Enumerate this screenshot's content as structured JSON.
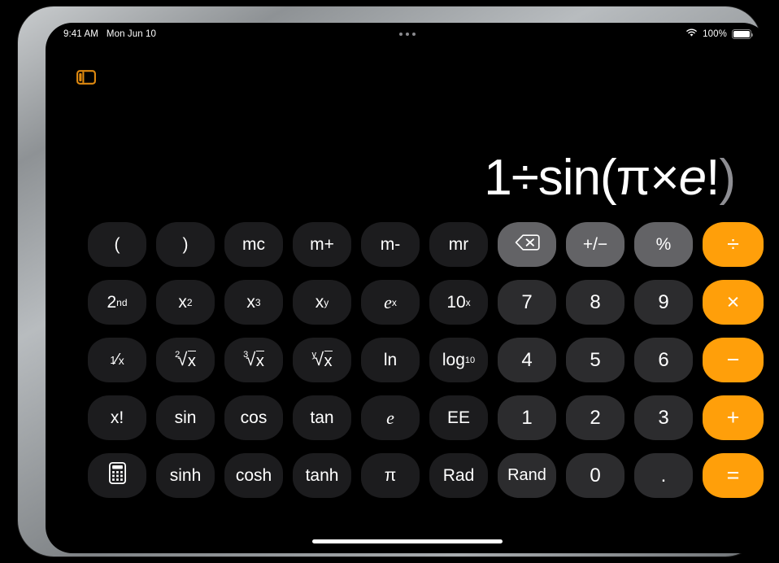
{
  "device": {
    "bezel_color": "#9a9ea1",
    "screen_bg": "#000000"
  },
  "status_bar": {
    "time": "9:41 AM",
    "date": "Mon Jun 10",
    "wifi_icon": "wifi-icon",
    "battery_percent": "100%",
    "battery_icon": "battery-icon",
    "multitask_icon": "multitask-dots-icon"
  },
  "toolbar": {
    "sidebar_toggle_icon": "sidebar-toggle-icon",
    "sidebar_toggle_color": "#e08a10"
  },
  "display": {
    "expression_parts": [
      {
        "text": "1÷sin(π×",
        "style": "normal"
      },
      {
        "text": "e",
        "style": "italic"
      },
      {
        "text": "!",
        "style": "normal"
      },
      {
        "text": ")",
        "style": "dim"
      }
    ],
    "expression_plain": "1÷sin(π×e!)",
    "text_color": "#ffffff",
    "dim_color": "#8e8e93"
  },
  "colors": {
    "function_key": "#1c1c1e",
    "number_key": "#2c2c2e",
    "utility_key": "#636366",
    "accent_key": "#ff9f0a",
    "label": "#ffffff"
  },
  "keypad": {
    "rows": [
      {
        "keys": [
          {
            "label": "(",
            "name": "key-open-paren",
            "kind": "fn"
          },
          {
            "label": ")",
            "name": "key-close-paren",
            "kind": "fn"
          },
          {
            "label": "mc",
            "name": "key-memory-clear",
            "kind": "fn"
          },
          {
            "label": "m+",
            "name": "key-memory-add",
            "kind": "fn"
          },
          {
            "label": "m-",
            "name": "key-memory-subtract",
            "kind": "fn"
          },
          {
            "label": "mr",
            "name": "key-memory-recall",
            "kind": "fn"
          },
          {
            "label": "",
            "name": "key-backspace",
            "kind": "util",
            "icon": "backspace-icon"
          },
          {
            "label": "+/−",
            "name": "key-sign-toggle",
            "kind": "util"
          },
          {
            "label": "%",
            "name": "key-percent",
            "kind": "util"
          },
          {
            "label": "÷",
            "name": "key-divide",
            "kind": "accent"
          }
        ]
      },
      {
        "keys": [
          {
            "label": "2nd",
            "name": "key-second-function",
            "kind": "fn",
            "base": "2",
            "sup": "nd"
          },
          {
            "label": "x²",
            "name": "key-x-squared",
            "kind": "fn",
            "base": "x",
            "sup": "2"
          },
          {
            "label": "x³",
            "name": "key-x-cubed",
            "kind": "fn",
            "base": "x",
            "sup": "3"
          },
          {
            "label": "xy",
            "name": "key-x-to-y",
            "kind": "fn",
            "base": "x",
            "sup": "y"
          },
          {
            "label": "ex",
            "name": "key-e-to-x",
            "kind": "fn",
            "base": "e",
            "sup": "x"
          },
          {
            "label": "10x",
            "name": "key-ten-to-x",
            "kind": "fn",
            "base": "10",
            "sup": "x"
          },
          {
            "label": "7",
            "name": "key-7",
            "kind": "num"
          },
          {
            "label": "8",
            "name": "key-8",
            "kind": "num"
          },
          {
            "label": "9",
            "name": "key-9",
            "kind": "num"
          },
          {
            "label": "×",
            "name": "key-multiply",
            "kind": "accent"
          }
        ]
      },
      {
        "keys": [
          {
            "label": "1/x",
            "name": "key-reciprocal",
            "kind": "fn"
          },
          {
            "label": "2√x",
            "name": "key-square-root",
            "kind": "fn",
            "radical_index": "2"
          },
          {
            "label": "3√x",
            "name": "key-cube-root",
            "kind": "fn",
            "radical_index": "3"
          },
          {
            "label": "y√x",
            "name": "key-nth-root",
            "kind": "fn",
            "radical_index": "y"
          },
          {
            "label": "ln",
            "name": "key-natural-log",
            "kind": "fn"
          },
          {
            "label": "log10",
            "name": "key-log-base-10",
            "kind": "fn",
            "base": "log",
            "sub": "10"
          },
          {
            "label": "4",
            "name": "key-4",
            "kind": "num"
          },
          {
            "label": "5",
            "name": "key-5",
            "kind": "num"
          },
          {
            "label": "6",
            "name": "key-6",
            "kind": "num"
          },
          {
            "label": "−",
            "name": "key-subtract",
            "kind": "accent"
          }
        ]
      },
      {
        "keys": [
          {
            "label": "x!",
            "name": "key-factorial",
            "kind": "fn"
          },
          {
            "label": "sin",
            "name": "key-sine",
            "kind": "fn"
          },
          {
            "label": "cos",
            "name": "key-cosine",
            "kind": "fn"
          },
          {
            "label": "tan",
            "name": "key-tangent",
            "kind": "fn"
          },
          {
            "label": "e",
            "name": "key-euler-number",
            "kind": "fn",
            "italic": true
          },
          {
            "label": "EE",
            "name": "key-exponent-entry",
            "kind": "fn"
          },
          {
            "label": "1",
            "name": "key-1",
            "kind": "num"
          },
          {
            "label": "2",
            "name": "key-2",
            "kind": "num"
          },
          {
            "label": "3",
            "name": "key-3",
            "kind": "num"
          },
          {
            "label": "+",
            "name": "key-add",
            "kind": "accent"
          }
        ]
      },
      {
        "keys": [
          {
            "label": "",
            "name": "key-calculator-mode",
            "kind": "fn",
            "icon": "calculator-icon"
          },
          {
            "label": "sinh",
            "name": "key-hyperbolic-sine",
            "kind": "fn"
          },
          {
            "label": "cosh",
            "name": "key-hyperbolic-cosine",
            "kind": "fn"
          },
          {
            "label": "tanh",
            "name": "key-hyperbolic-tangent",
            "kind": "fn"
          },
          {
            "label": "π",
            "name": "key-pi",
            "kind": "fn"
          },
          {
            "label": "Rad",
            "name": "key-radian-mode",
            "kind": "fn"
          },
          {
            "label": "Rand",
            "name": "key-random",
            "kind": "num"
          },
          {
            "label": "0",
            "name": "key-0",
            "kind": "num"
          },
          {
            "label": ".",
            "name": "key-decimal-point",
            "kind": "num"
          },
          {
            "label": "=",
            "name": "key-equals",
            "kind": "accent"
          }
        ]
      }
    ]
  },
  "home_indicator": {
    "name": "home-indicator"
  }
}
